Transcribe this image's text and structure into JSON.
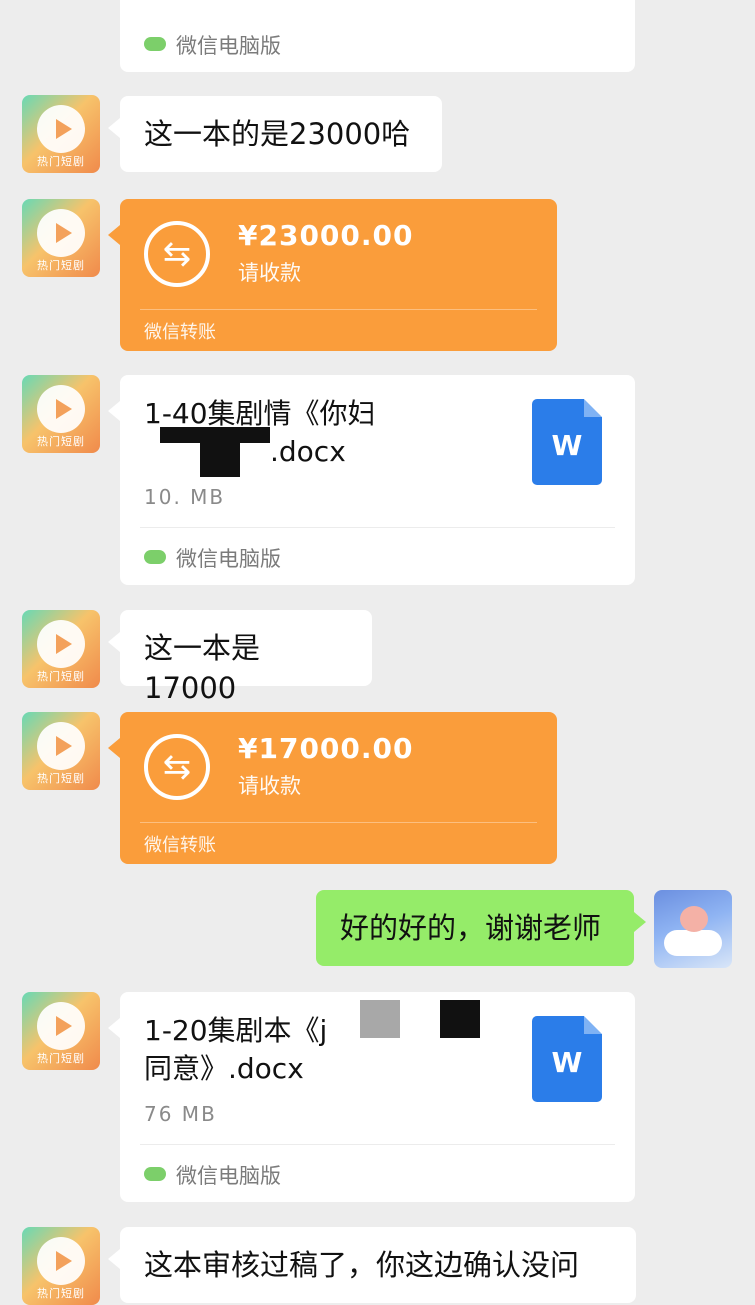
{
  "top_card": {
    "source": "微信电脑版"
  },
  "contact_avatar_label": "热门短剧",
  "messages": [
    {
      "type": "text",
      "text": "这一本的是23000哈"
    },
    {
      "type": "transfer",
      "amount": "¥23000.00",
      "status": "请收款",
      "footer": "微信转账"
    },
    {
      "type": "file",
      "name_line1": "1-40集剧情《你妇",
      "name_line2": ".docx",
      "size": "10. MB",
      "icon": "W",
      "source": "微信电脑版"
    },
    {
      "type": "text",
      "text": "这一本是17000"
    },
    {
      "type": "transfer",
      "amount": "¥17000.00",
      "status": "请收款",
      "footer": "微信转账"
    },
    {
      "type": "text_me",
      "text": "好的好的，谢谢老师"
    },
    {
      "type": "file",
      "name_line1": "1-20集剧本《j",
      "name_line2": "同意》.docx",
      "size": "76 MB",
      "icon": "W",
      "source": "微信电脑版"
    },
    {
      "type": "text",
      "text": "这本审核过稿了，你这边确认没问"
    }
  ],
  "colors": {
    "background": "#ededed",
    "transfer": "#fa9d3b",
    "me_bubble": "#95ec69",
    "word_icon": "#2b7de9"
  },
  "icons": [
    "wechat-icon",
    "transfer-icon",
    "word-file-icon"
  ]
}
